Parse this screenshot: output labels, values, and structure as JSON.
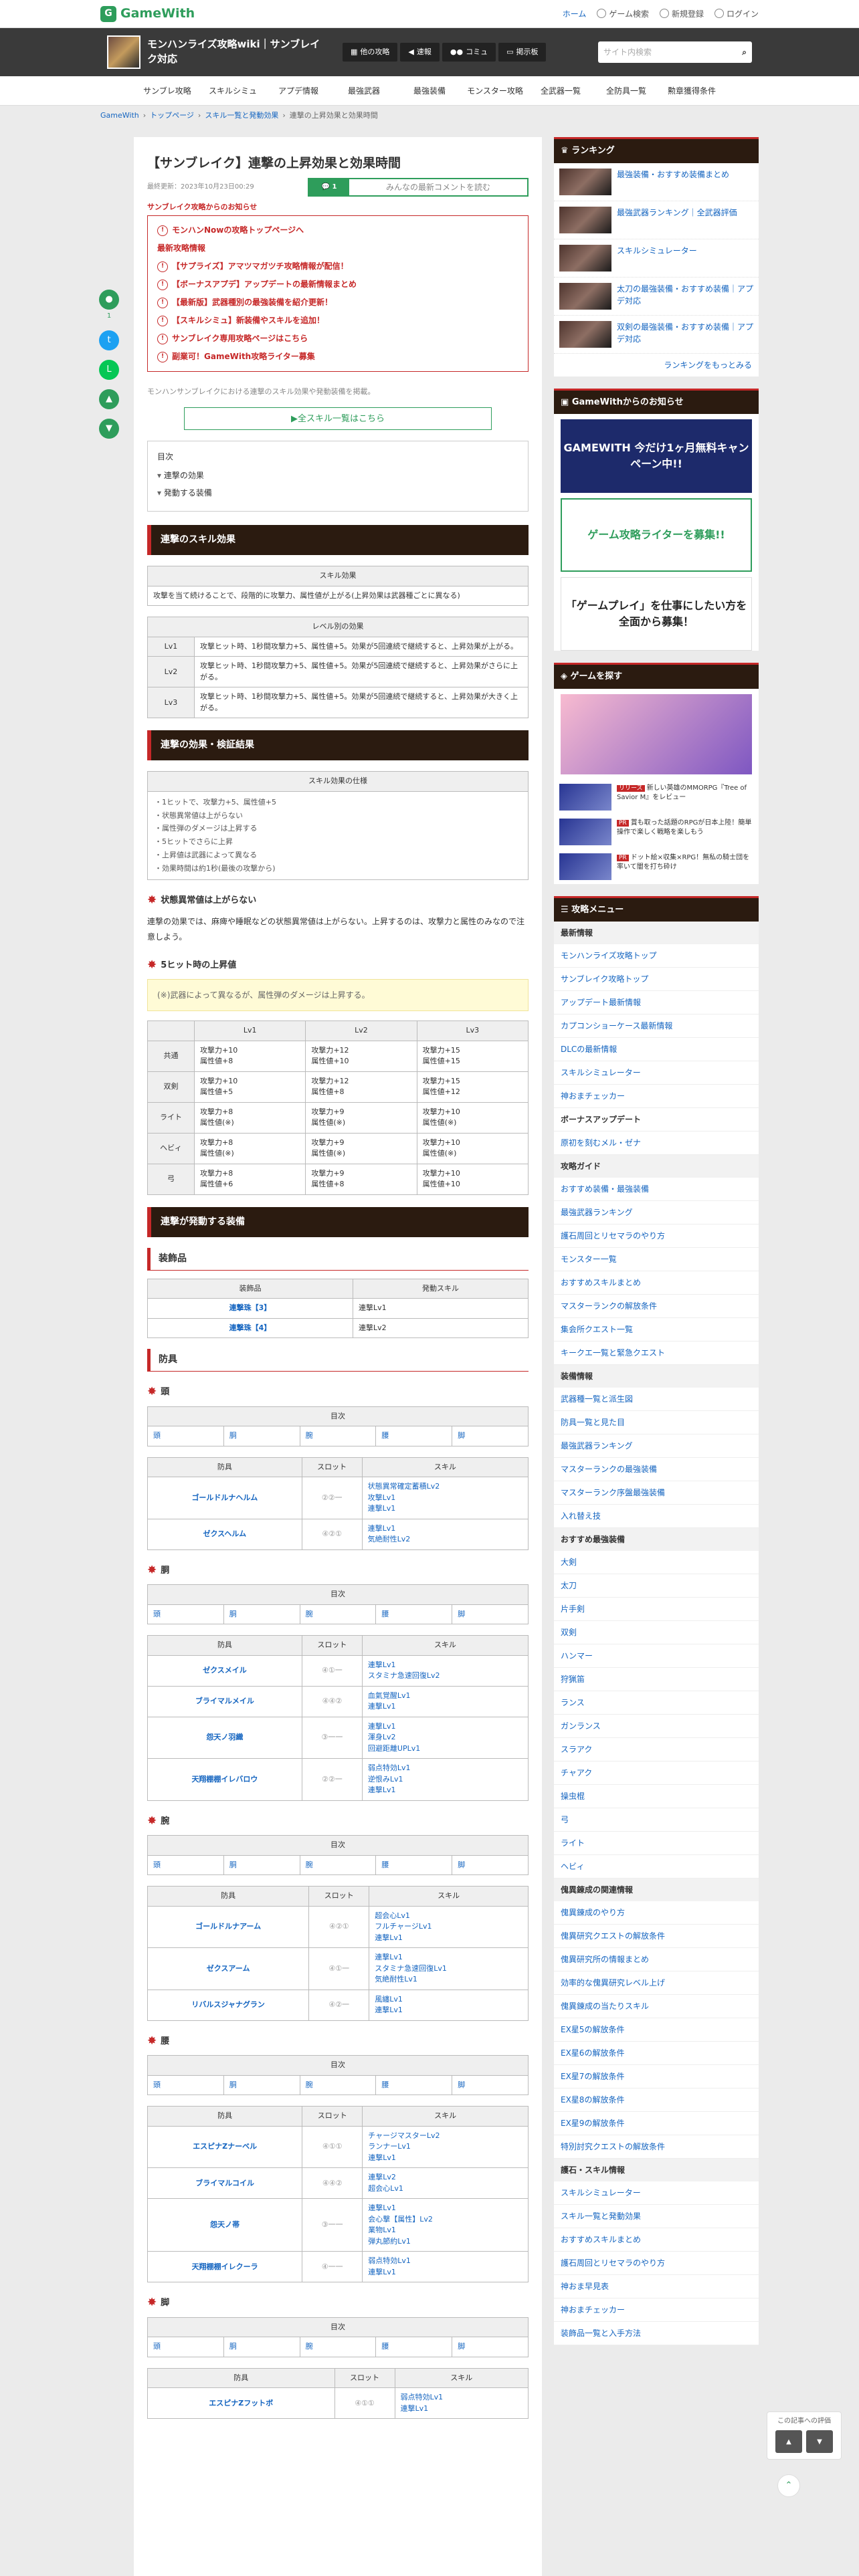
{
  "header": {
    "logo": "GameWith",
    "links": [
      "ホーム",
      "ゲーム検索",
      "新規登録",
      "ログイン"
    ]
  },
  "game": {
    "title": "モンハンライズ攻略wiki｜サンブレイク対応",
    "buttons": [
      "他の攻略",
      "速報",
      "コミュ",
      "掲示板"
    ],
    "search_placeholder": "サイト内検索"
  },
  "nav": [
    "サンブレ攻略",
    "スキルシミュ",
    "アプデ情報",
    "最強武器",
    "最強装備",
    "モンスター攻略",
    "全武器一覧",
    "全防具一覧",
    "勲章獲得条件"
  ],
  "breadcrumb": [
    "GameWith",
    "トップページ",
    "スキル一覧と発動効果",
    "連撃の上昇効果と効果時間"
  ],
  "article": {
    "title": "【サンブレイク】連撃の上昇効果と効果時間",
    "updated": "最終更新：2023年10月23日00:29",
    "comment_count": "1",
    "comment_label": "みんなの最新コメントを読む",
    "notice_head": "サンブレイク攻略からのお知らせ",
    "notice_top": "モンハンNowの攻略トップページへ",
    "notice_label": "最新攻略情報",
    "notices": [
      "【サプライズ】アマツマガツチ攻略情報が配信！",
      "【ボーナスアプデ】アップデートの最新情報まとめ",
      "【最新版】武器種別の最強装備を紹介更新！",
      "【スキルシミュ】新装備やスキルを追加！",
      "サンブレイク専用攻略ページはこちら",
      "副業可！GameWith攻略ライター募集"
    ],
    "intro": "モンハンサンブレイクにおける連撃のスキル効果や発動装備を掲載。",
    "all_skills": "▶全スキル一覧はこちら",
    "toc_title": "目次",
    "toc": [
      "連撃の効果",
      "発動する装備"
    ]
  },
  "sec1": {
    "title": "連撃のスキル効果",
    "skill_th": "スキル効果",
    "skill_desc": "攻撃を当て続けることで、段階的に攻撃力、属性値が上がる(上昇効果は武器種ごとに異なる)",
    "level_th": "レベル別の効果",
    "levels": [
      {
        "lv": "Lv1",
        "desc": "攻撃ヒット時、1秒間攻撃力+5、属性値+5。効果が5回連続で継続すると、上昇効果が上がる。"
      },
      {
        "lv": "Lv2",
        "desc": "攻撃ヒット時、1秒間攻撃力+5、属性値+5。効果が5回連続で継続すると、上昇効果がさらに上がる。"
      },
      {
        "lv": "Lv3",
        "desc": "攻撃ヒット時、1秒間攻撃力+5、属性値+5。効果が5回連続で継続すると、上昇効果が大きく上がる。"
      }
    ]
  },
  "sec2": {
    "title": "連撃の効果・検証結果",
    "spec_th": "スキル効果の仕様",
    "spec": [
      "・1ヒットで、攻撃力+5、属性値+5",
      "・状態異常値は上がらない",
      "・属性弾のダメージは上昇する",
      "・5ヒットでさらに上昇",
      "・上昇値は武器によって異なる",
      "・効果時間は約1秒(最後の攻撃から)"
    ],
    "h_status": "状態異常値は上がらない",
    "status_text": "連撃の効果では、麻痺や睡眠などの状態異常値は上がらない。上昇するのは、攻撃力と属性のみなので注意しよう。",
    "h_five": "5ヒット時の上昇値",
    "five_note": "(※)武器によって異なるが、属性弾のダメージは上昇する。",
    "cols": [
      "",
      "Lv1",
      "Lv2",
      "Lv3"
    ],
    "rows": [
      {
        "w": "共通",
        "a": "攻撃力+10\n属性値+8",
        "b": "攻撃力+12\n属性値+10",
        "c": "攻撃力+15\n属性値+15"
      },
      {
        "w": "双剣",
        "a": "攻撃力+10\n属性値+5",
        "b": "攻撃力+12\n属性値+8",
        "c": "攻撃力+15\n属性値+12"
      },
      {
        "w": "ライト",
        "a": "攻撃力+8\n属性値(※)",
        "b": "攻撃力+9\n属性値(※)",
        "c": "攻撃力+10\n属性値(※)"
      },
      {
        "w": "ヘビィ",
        "a": "攻撃力+8\n属性値(※)",
        "b": "攻撃力+9\n属性値(※)",
        "c": "攻撃力+10\n属性値(※)"
      },
      {
        "w": "弓",
        "a": "攻撃力+8\n属性値+6",
        "b": "攻撃力+9\n属性値+8",
        "c": "攻撃力+10\n属性値+10"
      }
    ]
  },
  "sec3": {
    "title": "連撃が発動する装備",
    "deco_title": "装飾品",
    "deco_cols": [
      "装飾品",
      "発動スキル"
    ],
    "decos": [
      [
        "連撃珠【3】",
        "連撃Lv1"
      ],
      [
        "連撃珠【4】",
        "連撃Lv2"
      ]
    ],
    "armor_title": "防具",
    "toc_label": "目次",
    "parts_nav": [
      "頭",
      "胴",
      "腕",
      "腰",
      "脚"
    ],
    "cols": [
      "防具",
      "スロット",
      "スキル"
    ],
    "groups": [
      {
        "name": "頭",
        "items": [
          {
            "n": "ゴールドルナヘルム",
            "s": "②②一",
            "k": [
              "状態異常確定蓄積Lv2",
              "攻撃Lv1",
              "連撃Lv1"
            ]
          },
          {
            "n": "ゼクスヘルム",
            "s": "④②①",
            "k": [
              "連撃Lv1",
              "気絶耐性Lv2"
            ]
          }
        ]
      },
      {
        "name": "胴",
        "items": [
          {
            "n": "ゼクスメイル",
            "s": "④①一",
            "k": [
              "連撃Lv1",
              "スタミナ急速回復Lv2"
            ]
          },
          {
            "n": "ブライマルメイル",
            "s": "④④②",
            "k": [
              "血氣覚醒Lv1",
              "連撃Lv1"
            ]
          },
          {
            "n": "怨天ノ羽織",
            "s": "③一一",
            "k": [
              "連撃Lv1",
              "渾身Lv2",
              "回避距離UPLv1"
            ]
          },
          {
            "n": "天翔棚棚イレバロウ",
            "s": "②②一",
            "k": [
              "弱点特効Lv1",
              "逆恨みLv1",
              "連撃Lv1"
            ]
          }
        ]
      },
      {
        "name": "腕",
        "items": [
          {
            "n": "ゴールドルナアーム",
            "s": "④②①",
            "k": [
              "超会心Lv1",
              "フルチャージLv1",
              "連撃Lv1"
            ]
          },
          {
            "n": "ゼクスアーム",
            "s": "④①一",
            "k": [
              "連撃Lv1",
              "スタミナ急速回復Lv1",
              "気絶耐性Lv1"
            ]
          },
          {
            "n": "リバルスジャナグラン",
            "s": "④②一",
            "k": [
              "風纏Lv1",
              "連撃Lv1"
            ]
          }
        ]
      },
      {
        "name": "腰",
        "items": [
          {
            "n": "エスピナZナーベル",
            "s": "④①①",
            "k": [
              "チャージマスターLv2",
              "ランナーLv1",
              "連撃Lv1"
            ]
          },
          {
            "n": "ブライマルコイル",
            "s": "④④②",
            "k": [
              "連撃Lv2",
              "超会心Lv1"
            ]
          },
          {
            "n": "怨天ノ帯",
            "s": "③一一",
            "k": [
              "連撃Lv1",
              "会心撃【属性】Lv2",
              "業物Lv1",
              "弾丸節約Lv1"
            ]
          },
          {
            "n": "天翔棚棚イレクーラ",
            "s": "④一一",
            "k": [
              "弱点特効Lv1",
              "連撃Lv1"
            ]
          }
        ]
      },
      {
        "name": "脚",
        "items": [
          {
            "n": "エスピナZフットボ",
            "s": "④①①",
            "k": [
              "弱点特効Lv1",
              "連撃Lv1"
            ]
          }
        ]
      }
    ]
  },
  "sidebar": {
    "ranking_title": "ランキング",
    "ranking": [
      "最強装備・おすすめ装備まとめ",
      "最強武器ランキング｜全武器評価",
      "スキルシミュレーター",
      "太刀の最強装備・おすすめ装備｜アプデ対応",
      "双剣の最強装備・おすすめ装備｜アプデ対応"
    ],
    "ranking_more": "ランキングをもっとみる",
    "news_title": "GameWithからのお知らせ",
    "banners": [
      "GAMEWITH 今だけ1ヶ月無料キャンペーン中!!",
      "ゲーム攻略ライターを募集!!",
      "「ゲームプレイ」を仕事にしたい方を全面から募集！"
    ],
    "games_title": "ゲームを探す",
    "game_ads": [
      {
        "tag": "リリース",
        "t": "新しい英雄のMMORPG『Tree of Savior M』をレビュー"
      },
      {
        "tag": "PR",
        "t": "賞も取った話題のRPGが日本上陸！簡単操作で楽しく戦略を楽しもう"
      },
      {
        "tag": "PR",
        "t": "ドット絵×収集×RPG！無私の騎士団を率いて闇を打ち砕け"
      }
    ],
    "menu_title": "攻略メニュー",
    "menu": [
      {
        "h": "最新情報",
        "items": [
          "モンハンライズ攻略トップ",
          "サンブレイク攻略トップ",
          "アップデート最新情報",
          "カプコンショーケース最新情報",
          "DLCの最新情報",
          "スキルシミュレーター",
          "神おまチェッカー",
          "ボーナスアップデート",
          "原初を刻むメル・ゼナ"
        ]
      },
      {
        "h": "攻略ガイド",
        "items": [
          "おすすめ装備・最強装備",
          "最強武器ランキング",
          "護石周回とリセマラのやり方",
          "モンスター一覧",
          "おすすめスキルまとめ",
          "マスターランクの解放条件",
          "集会所クエスト一覧",
          "キークエ一覧と緊急クエスト"
        ]
      },
      {
        "h": "装備情報",
        "items": [
          "武器種一覧と派生図",
          "防具一覧と見た目",
          "最強武器ランキング",
          "マスターランクの最強装備",
          "マスターランク序盤最強装備",
          "入れ替え技"
        ]
      },
      {
        "h": "おすすめ最強装備",
        "items": [
          "大剣",
          "太刀",
          "片手剣",
          "双剣",
          "ハンマー",
          "狩猟笛",
          "ランス",
          "ガンランス",
          "スラアク",
          "チャアク",
          "操虫棍",
          "弓",
          "ライト",
          "ヘビィ"
        ]
      },
      {
        "h": "傀異錬成の関連情報",
        "items": [
          "傀異錬成のやり方",
          "傀異研究クエストの解放条件",
          "傀異研究所の情報まとめ",
          "効率的な傀異研究レベル上げ",
          "傀異錬成の当たりスキル",
          "EX星5の解放条件",
          "EX星6の解放条件",
          "EX星7の解放条件",
          "EX星8の解放条件",
          "EX星9の解放条件",
          "特別討究クエストの解放条件"
        ]
      },
      {
        "h": "護石・スキル情報",
        "items": [
          "スキルシミュレーター",
          "スキル一覧と発動効果",
          "おすすめスキルまとめ",
          "護石周回とリセマラのやり方",
          "神おま早見表",
          "神おまチェッカー",
          "装飾品一覧と入手方法"
        ]
      }
    ],
    "eval_label": "この記事への評価"
  }
}
